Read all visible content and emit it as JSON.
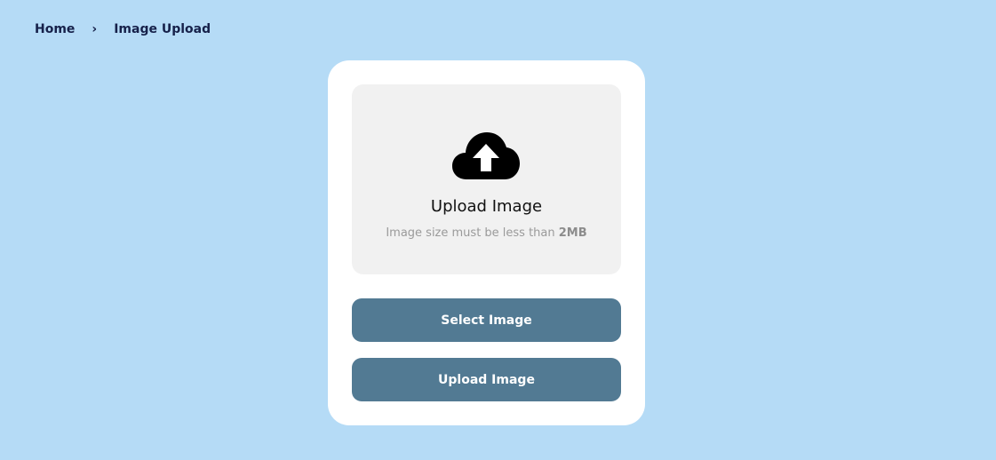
{
  "breadcrumb": {
    "home": "Home",
    "separator": "›",
    "current": "Image Upload"
  },
  "dropzone": {
    "icon": "cloud-upload-icon",
    "title": "Upload Image",
    "hint_prefix": "Image size must be less than ",
    "hint_limit": "2MB"
  },
  "buttons": {
    "select_label": "Select Image",
    "upload_label": "Upload Image"
  },
  "colors": {
    "background": "#b5dbf6",
    "card": "#ffffff",
    "dropzone": "#f1f1f1",
    "button": "#527a93",
    "breadcrumb_text": "#16214a"
  }
}
